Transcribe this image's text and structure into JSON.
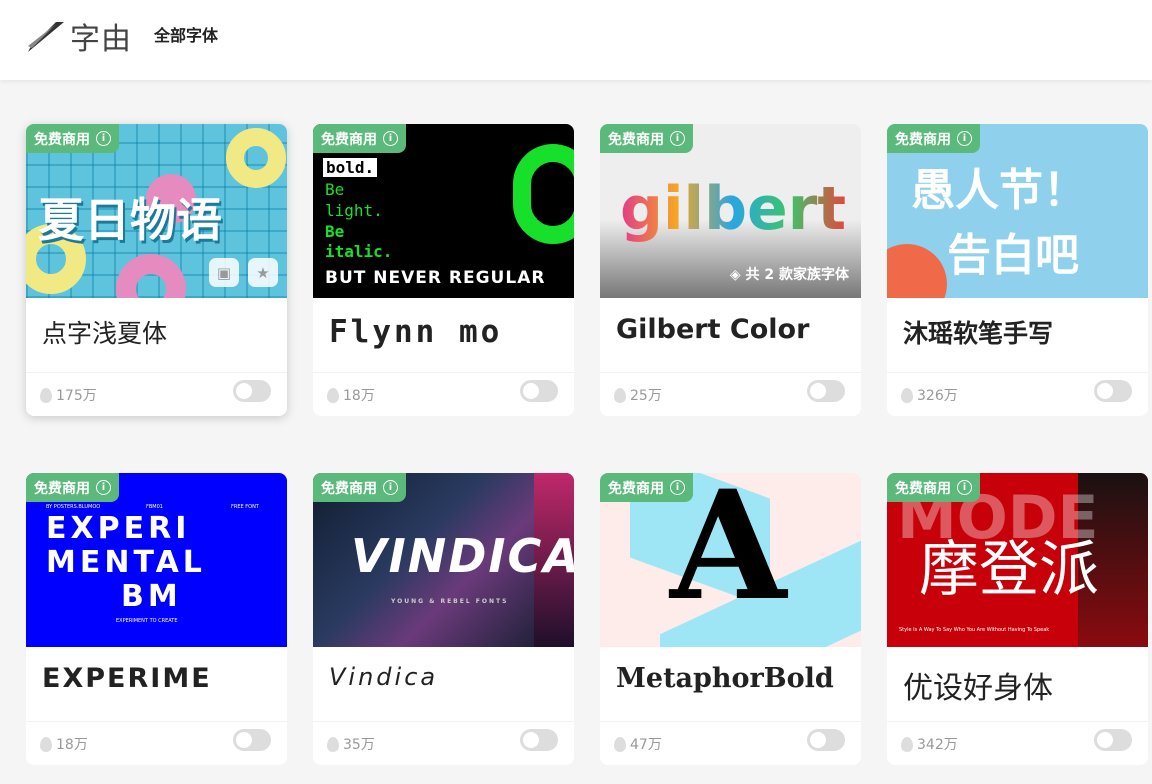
{
  "header": {
    "logo_text": "字由",
    "nav_label": "全部字体"
  },
  "badge_label": "免费商用",
  "cards": [
    {
      "thumb_text": "夏日物语",
      "name": "点字浅夏体",
      "hot": "175万"
    },
    {
      "thumb_lines": [
        "bold.",
        "Be",
        "light.",
        "Be",
        "italic.",
        "BUT NEVER REGULAR"
      ],
      "name": "Flynn mo",
      "hot": "18万"
    },
    {
      "thumb_text": "gilbert",
      "family_note": "共 2 款家族字体",
      "name": "Gilbert Color",
      "hot": "25万"
    },
    {
      "thumb_lines": [
        "愚人节！",
        "告白吧"
      ],
      "name": "沐瑶软笔手写",
      "hot": "326万"
    },
    {
      "thumb_lines": [
        "EXPERI",
        "MENTAL",
        "BM"
      ],
      "thumb_small": [
        "BY POSTERS.BLUMOO",
        "FBM01",
        "FREE FONT",
        "EXPERIMENT TO CREATE"
      ],
      "name": "EXPERIME",
      "hot": "18万"
    },
    {
      "thumb_text": "VINDICA",
      "thumb_sub": "YOUNG & REBEL FONTS",
      "name": "Vindica",
      "hot": "35万"
    },
    {
      "thumb_text": "A",
      "name": "MetaphorBold",
      "hot": "47万"
    },
    {
      "thumb_text": "摩登派",
      "thumb_bg_text": "MODE",
      "thumb_sub": "Style Is A Way To Say Who You Are Without Having To Speak",
      "name": "优设好身体",
      "hot": "342万"
    }
  ],
  "colors": {
    "badge": "#5bb97b",
    "toggle_off": "#dddddd"
  }
}
